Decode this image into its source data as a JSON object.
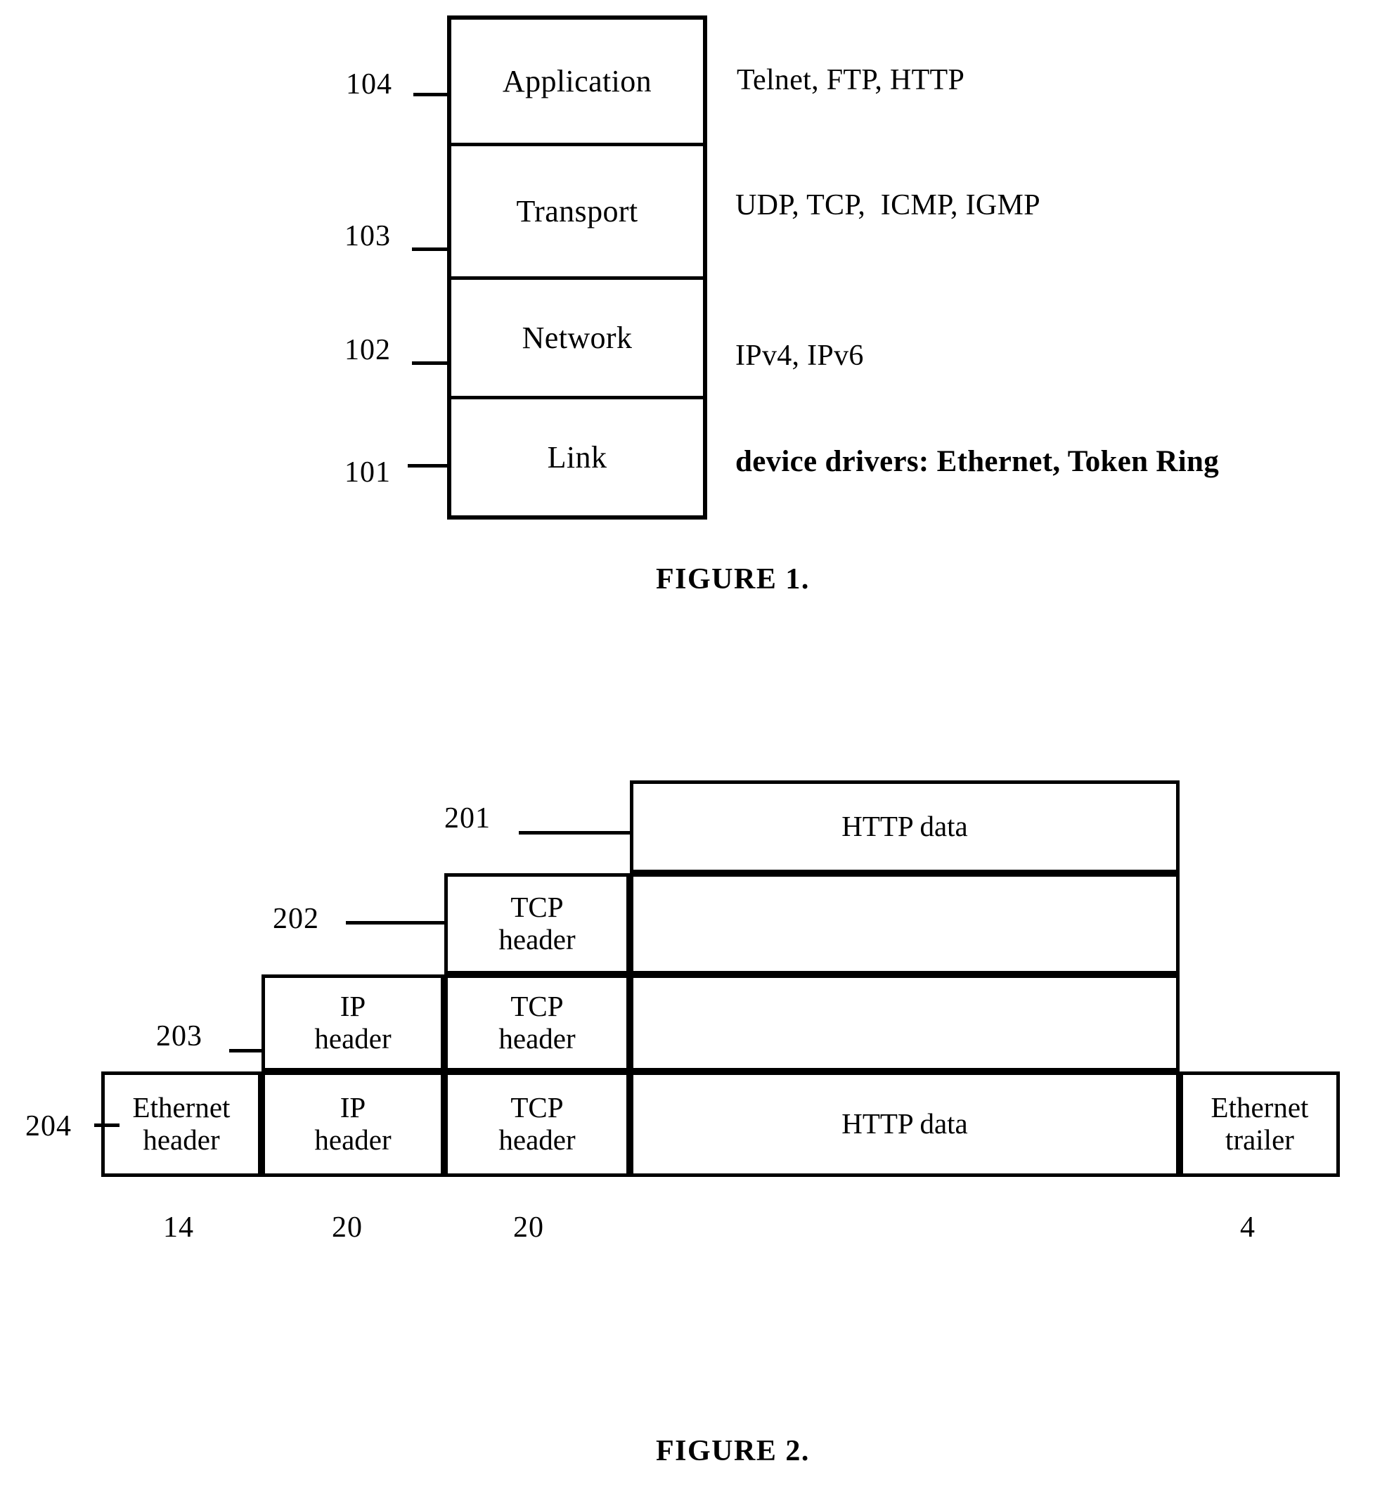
{
  "figure1": {
    "caption": "FIGURE 1.",
    "layers": [
      {
        "ref": "104",
        "name": "Application",
        "protocols": "Telnet, FTP, HTTP"
      },
      {
        "ref": "103",
        "name": "Transport",
        "protocols": "UDP, TCP,  ICMP, IGMP"
      },
      {
        "ref": "102",
        "name": "Network",
        "protocols": "IPv4, IPv6"
      },
      {
        "ref": "101",
        "name": "Link",
        "protocols": "device drivers: Ethernet, Token Ring"
      }
    ]
  },
  "figure2": {
    "caption": "FIGURE 2.",
    "refs": {
      "http_data": "201",
      "tcp_header": "202",
      "ip_header": "203",
      "ethernet_frame": "204"
    },
    "rows": [
      {
        "ref": "201",
        "cells": [
          {
            "label": "HTTP data"
          }
        ]
      },
      {
        "ref": "202",
        "cells": [
          {
            "label": "TCP\nheader"
          },
          {
            "label": ""
          }
        ]
      },
      {
        "ref": "203",
        "cells": [
          {
            "label": "IP\nheader"
          },
          {
            "label": "TCP\nheader"
          },
          {
            "label": ""
          }
        ]
      },
      {
        "ref": "204",
        "cells": [
          {
            "label": "Ethernet\nheader"
          },
          {
            "label": "IP\nheader"
          },
          {
            "label": "TCP\nheader"
          },
          {
            "label": "HTTP data"
          },
          {
            "label": "Ethernet\ntrailer"
          }
        ]
      }
    ],
    "byte_sizes": [
      {
        "value": "14",
        "field": "Ethernet header"
      },
      {
        "value": "20",
        "field": "IP header"
      },
      {
        "value": "20",
        "field": "TCP header"
      },
      {
        "value": "4",
        "field": "Ethernet trailer"
      }
    ]
  }
}
